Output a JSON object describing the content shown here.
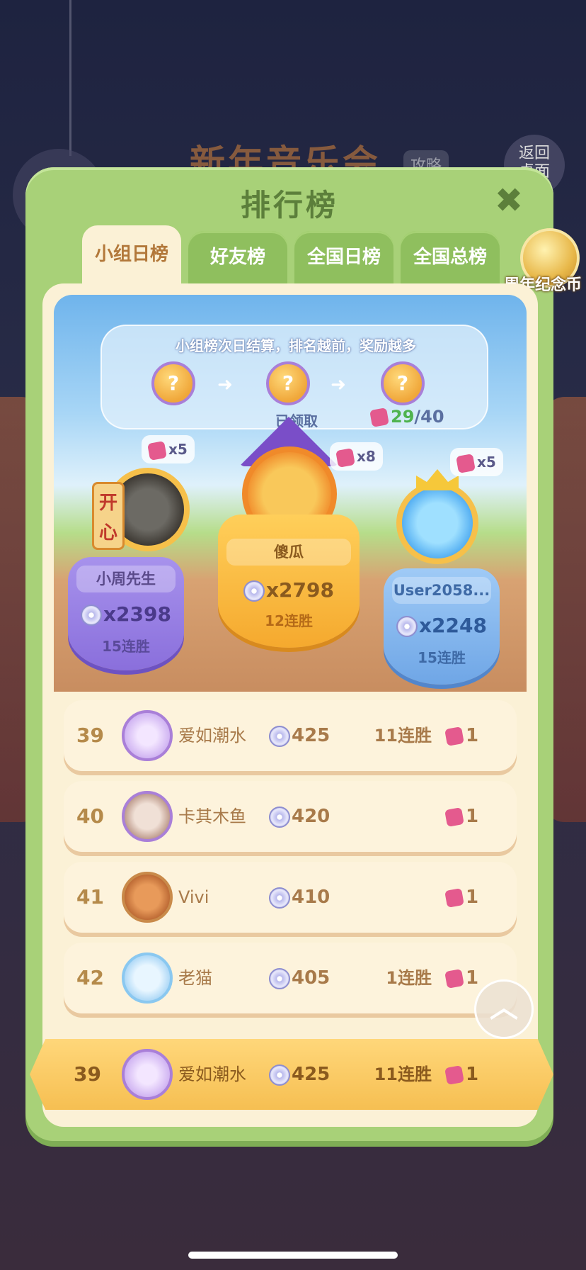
{
  "background": {
    "event_title": "新年音乐会",
    "event_tag": "攻略",
    "back_button": "返回\n桌面"
  },
  "modal": {
    "title": "排行榜",
    "close_icon": "close-icon",
    "tabs": [
      {
        "label": "小组日榜",
        "active": true
      },
      {
        "label": "好友榜",
        "active": false
      },
      {
        "label": "全国日榜",
        "active": false
      },
      {
        "label": "全国总榜",
        "active": false
      }
    ],
    "coin_badge_label": "周年纪念币"
  },
  "info": {
    "text": "小组榜次日结算，排名越前，奖励越多",
    "claimed_label": "已领取",
    "progress_current": "29",
    "progress_total": "/40"
  },
  "podium": [
    {
      "rank": 2,
      "name": "小周先生",
      "score": "x2398",
      "streak": "15连胜",
      "reward": "x5",
      "tag": "开心"
    },
    {
      "rank": 1,
      "name": "傻瓜",
      "score": "x2798",
      "streak": "12连胜",
      "reward": "x8"
    },
    {
      "rank": 3,
      "name": "User2058...",
      "score": "x2248",
      "streak": "15连胜",
      "reward": "x5"
    }
  ],
  "rows": [
    {
      "rank": "39",
      "name": "爱如潮水",
      "score": "425",
      "streak": "11连胜",
      "fragments": "1",
      "avatar": "cat-guitar"
    },
    {
      "rank": "40",
      "name": "卡其木鱼",
      "score": "420",
      "streak": "",
      "fragments": "1",
      "avatar": "photo"
    },
    {
      "rank": "41",
      "name": "Vivi",
      "score": "410",
      "streak": "",
      "fragments": "1",
      "avatar": "bear"
    },
    {
      "rank": "42",
      "name": "老猫",
      "score": "405",
      "streak": "1连胜",
      "fragments": "1",
      "avatar": "blue"
    }
  ],
  "self_row": {
    "rank": "39",
    "name": "爱如潮水",
    "score": "425",
    "streak": "11连胜",
    "fragments": "1"
  },
  "colors": {
    "modal_green": "#a8d178",
    "panel_cream": "#fbf1d6",
    "gold": "#f6bf52",
    "purple": "#8a6fdc",
    "blue": "#6fa6e6"
  }
}
